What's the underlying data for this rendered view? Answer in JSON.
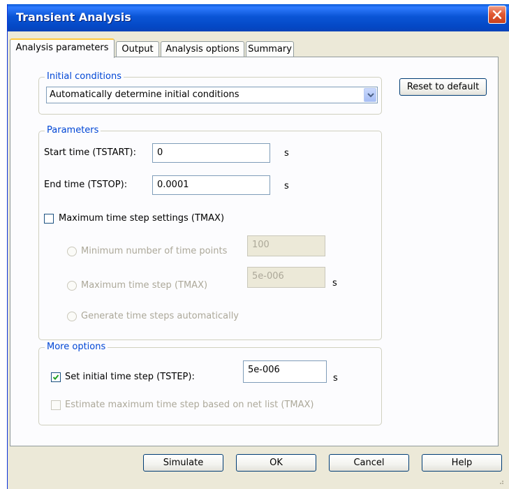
{
  "window": {
    "title": "Transient Analysis"
  },
  "tabs": [
    {
      "label": "Analysis parameters",
      "active": true
    },
    {
      "label": "Output",
      "active": false
    },
    {
      "label": "Analysis options",
      "active": false
    },
    {
      "label": "Summary",
      "active": false
    }
  ],
  "initial_conditions": {
    "group_label": "Initial conditions",
    "selected": "Automatically determine initial conditions"
  },
  "reset_button": "Reset to default",
  "parameters": {
    "group_label": "Parameters",
    "start_time": {
      "label": "Start time (TSTART):",
      "value": "0",
      "unit": "s"
    },
    "end_time": {
      "label": "End time (TSTOP):",
      "value": "0.0001",
      "unit": "s"
    },
    "max_step_settings": {
      "label": "Maximum time step settings (TMAX)",
      "checked": false
    },
    "min_time_points": {
      "label": "Minimum number of time points",
      "value": "100",
      "enabled": false
    },
    "max_time_step": {
      "label": "Maximum time step (TMAX)",
      "value": "5e-006",
      "unit": "s",
      "enabled": false
    },
    "generate_auto": {
      "label": "Generate time steps automatically",
      "enabled": false
    }
  },
  "more_options": {
    "group_label": "More options",
    "set_initial_step": {
      "label": "Set initial time step (TSTEP):",
      "checked": true,
      "value": "5e-006",
      "unit": "s"
    },
    "estimate_max_step": {
      "label": "Estimate maximum time step based on net list (TMAX)",
      "checked": false,
      "enabled": false
    }
  },
  "buttons": {
    "simulate": "Simulate",
    "ok": "OK",
    "cancel": "Cancel",
    "help": "Help"
  },
  "colors": {
    "titlebar": "#0a55d6",
    "group_label": "#0046d5",
    "dialog_bg": "#ece9d8",
    "close_button": "#e25a34"
  }
}
